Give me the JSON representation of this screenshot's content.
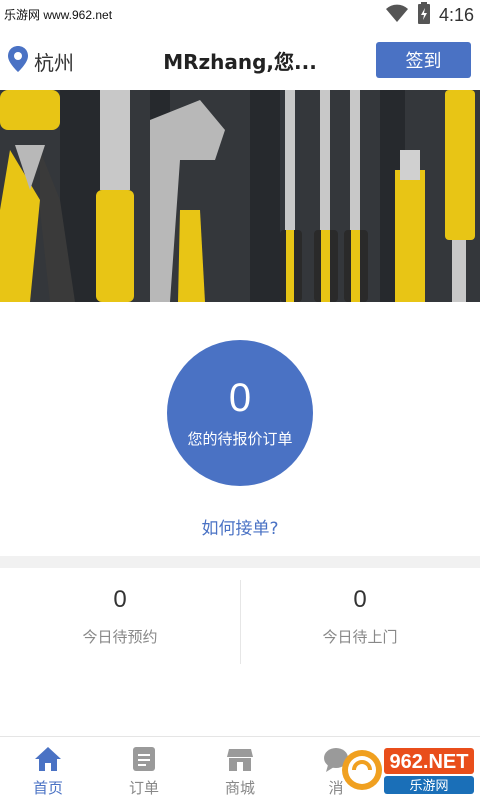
{
  "status_bar": {
    "watermark": "乐游网 www.962.net",
    "time": "4:16"
  },
  "header": {
    "city": "杭州",
    "greeting": "MRzhang,您...",
    "signin_label": "签到"
  },
  "pending": {
    "count": "0",
    "label": "您的待报价订单"
  },
  "howto_link": "如何接单?",
  "stats": [
    {
      "value": "0",
      "label": "今日待预约"
    },
    {
      "value": "0",
      "label": "今日待上门"
    }
  ],
  "bottom_nav": {
    "items": [
      {
        "label": "首页",
        "icon": "home-icon",
        "active": true
      },
      {
        "label": "订单",
        "icon": "document-icon"
      },
      {
        "label": "商城",
        "icon": "store-icon"
      },
      {
        "label": "消",
        "icon": "message-icon"
      }
    ]
  },
  "brand_watermark": {
    "text": "962.NET",
    "subtext": "乐游网"
  },
  "colors": {
    "accent": "#4a72c4"
  }
}
